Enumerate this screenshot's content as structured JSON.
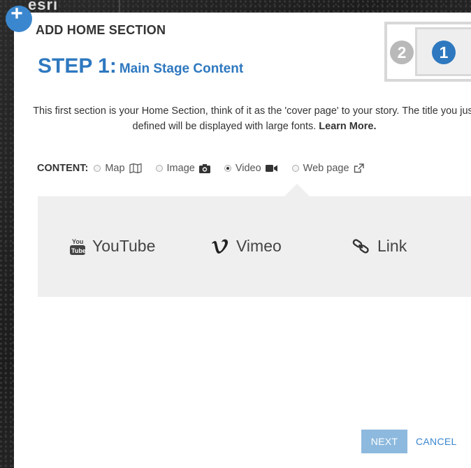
{
  "background": {
    "logo_text": "esri"
  },
  "add_badge": {
    "symbol": "+",
    "color": "#3b87cf"
  },
  "dialog": {
    "title": "ADD HOME SECTION",
    "step_label": "STEP 1:",
    "step_subtitle": "Main Stage Content",
    "layout_preview": {
      "step_secondary": "2",
      "step_current": "1"
    },
    "intro_text": "This first section is your Home Section, think of it as the 'cover page' to your story. The title you just defined will be displayed with large fonts.",
    "learn_more": "Learn More."
  },
  "content": {
    "label": "CONTENT:",
    "selected": "Video",
    "options": [
      {
        "label": "Map",
        "icon": "map-icon"
      },
      {
        "label": "Image",
        "icon": "camera-icon"
      },
      {
        "label": "Video",
        "icon": "video-camera-icon"
      },
      {
        "label": "Web page",
        "icon": "external-link-icon"
      }
    ]
  },
  "video_sources": [
    {
      "label": "YouTube",
      "icon": "youtube-icon"
    },
    {
      "label": "Vimeo",
      "icon": "vimeo-icon"
    },
    {
      "label": "Link",
      "icon": "link-icon"
    }
  ],
  "buttons": {
    "next": "NEXT",
    "cancel": "CANCEL"
  },
  "colors": {
    "accent": "#2e78bf",
    "next_button": "#8db9de",
    "panel": "#efefef"
  }
}
